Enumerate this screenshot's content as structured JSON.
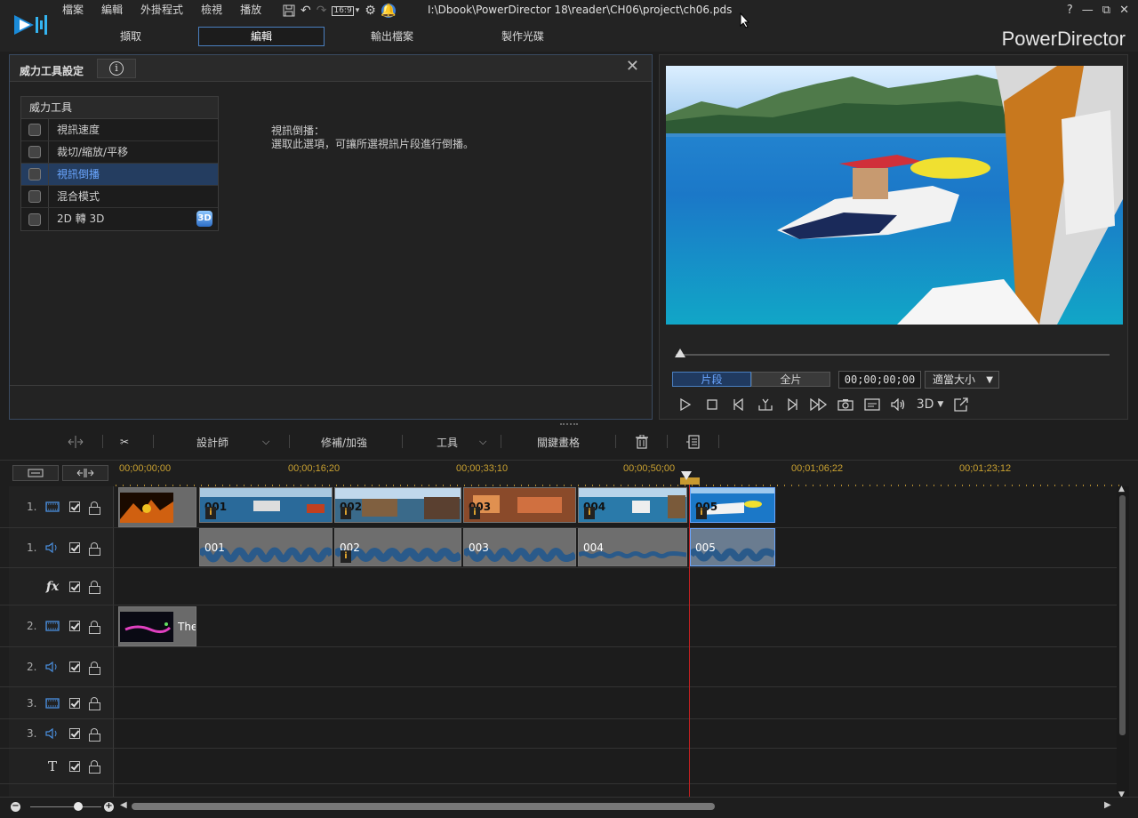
{
  "app": {
    "brand": "PowerDirector",
    "file_path": "I:\\Dbook\\PowerDirector 18\\reader\\CH06\\project\\ch06.pds",
    "aspect_ratio": "16:9"
  },
  "menu": [
    "檔案",
    "編輯",
    "外掛程式",
    "檢視",
    "播放"
  ],
  "window_controls": [
    "?",
    "—",
    "⧉",
    "✕"
  ],
  "tabs": [
    {
      "label": "擷取",
      "active": false
    },
    {
      "label": "編輯",
      "active": true
    },
    {
      "label": "輸出檔案",
      "active": false
    },
    {
      "label": "製作光碟",
      "active": false
    }
  ],
  "power_tools": {
    "title": "威力工具設定",
    "info_icon": "info-icon",
    "close_icon": "close-icon",
    "header": "威力工具",
    "items": [
      {
        "label": "視訊速度",
        "checked": false,
        "selected": false
      },
      {
        "label": "裁切/縮放/平移",
        "checked": false,
        "selected": false
      },
      {
        "label": "視訊倒播",
        "checked": false,
        "selected": true
      },
      {
        "label": "混合模式",
        "checked": false,
        "selected": false
      },
      {
        "label": "2D 轉 3D",
        "checked": false,
        "selected": false,
        "badge": "3D"
      }
    ],
    "description_title": "視訊倒播：",
    "description_body": "選取此選項，可讓所選視訊片段進行倒播。"
  },
  "preview": {
    "mode_clip": "片段",
    "mode_movie": "全片",
    "active_mode": "clip",
    "timecode": "00;00;00;00",
    "fit_label": "適當大小",
    "three_d_label": "3D",
    "controls": [
      "play-icon",
      "stop-icon",
      "prev-frame-icon",
      "split-icon",
      "next-frame-icon",
      "fast-forward-icon",
      "snapshot-icon",
      "subtitle-icon",
      "volume-icon",
      "3d-icon",
      "undock-icon"
    ]
  },
  "toolbar": {
    "designer": "設計師",
    "fix_enhance": "修補/加強",
    "tools": "工具",
    "keyframe": "關鍵畫格"
  },
  "ruler": {
    "labels": [
      "00;00;00;00",
      "00;00;16;20",
      "00;00;33;10",
      "00;00;50;00",
      "00;01;06;22",
      "00;01;23;12"
    ]
  },
  "tracks": [
    {
      "num": "1.",
      "type": "video",
      "icon": "video-track-icon"
    },
    {
      "num": "1.",
      "type": "audio",
      "icon": "audio-track-icon"
    },
    {
      "num": "",
      "type": "fx",
      "icon": "fx-track-icon",
      "label": "fx"
    },
    {
      "num": "2.",
      "type": "video",
      "icon": "video-track-icon"
    },
    {
      "num": "2.",
      "type": "audio",
      "icon": "audio-track-icon"
    },
    {
      "num": "3.",
      "type": "video",
      "icon": "video-track-icon"
    },
    {
      "num": "3.",
      "type": "audio",
      "icon": "audio-track-icon"
    },
    {
      "num": "",
      "type": "title",
      "icon": "title-track-icon",
      "label": "T"
    }
  ],
  "clips": {
    "video": [
      "001",
      "002",
      "003",
      "004",
      "005"
    ],
    "audio": [
      "001",
      "002",
      "003",
      "004",
      "005"
    ],
    "title_clip_label": "The"
  },
  "colors": {
    "accent": "#4a7fc0",
    "selected_text": "#6aa6ff",
    "ruler_text": "#c8a030",
    "playhead": "#c02020"
  }
}
